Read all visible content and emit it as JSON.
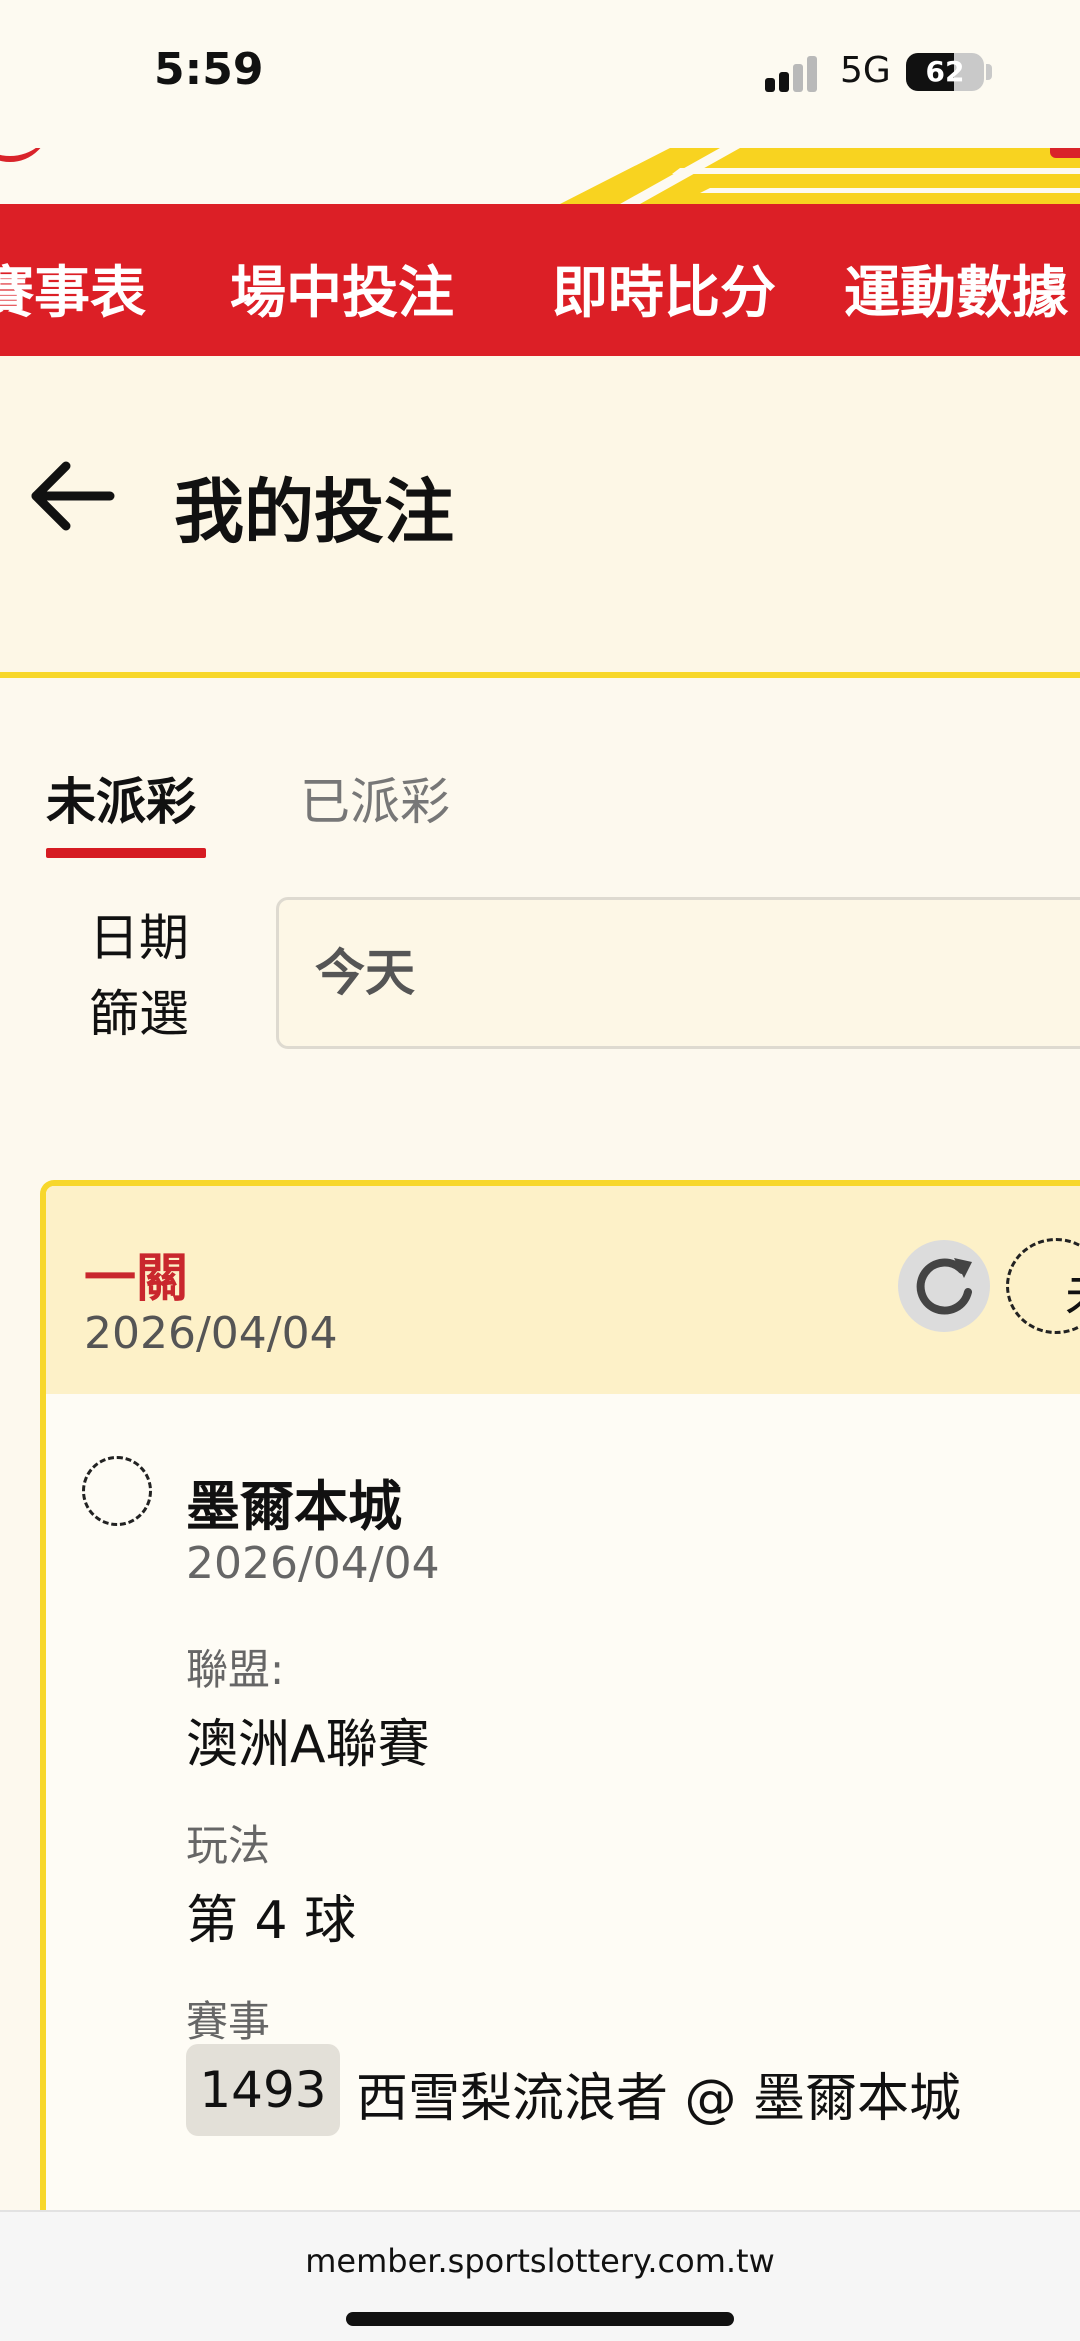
{
  "status_bar": {
    "time": "5:59",
    "network": "5G",
    "battery": "62",
    "battery_level": 0.62
  },
  "nav": {
    "items": [
      "賽事表",
      "場中投注",
      "即時比分",
      "運動數據"
    ]
  },
  "header": {
    "back_icon": "arrow-left-icon",
    "title": "我的投注"
  },
  "tabs": [
    {
      "label": "未派彩",
      "active": true
    },
    {
      "label": "已派彩",
      "active": false
    }
  ],
  "filter": {
    "label_line1": "日期",
    "label_line2": "篩選",
    "value": "今天"
  },
  "bet_card": {
    "type": "一關",
    "date": "2026/04/04",
    "refresh_icon": "refresh-icon",
    "status_text": "未",
    "selection": {
      "team": "墨爾本城",
      "date": "2026/04/04",
      "league_label": "聯盟:",
      "league": "澳洲A聯賽",
      "play_label": "玩法",
      "play": "第 4 球",
      "match_label": "賽事",
      "match_no": "1493",
      "match": "西雪梨流浪者 @ 墨爾本城"
    }
  },
  "browser": {
    "url": "member.sportslottery.com.tw"
  },
  "colors": {
    "brand_red": "#dc1f26",
    "accent_yellow": "#f7d72b",
    "card_header": "#fdf1c8"
  }
}
